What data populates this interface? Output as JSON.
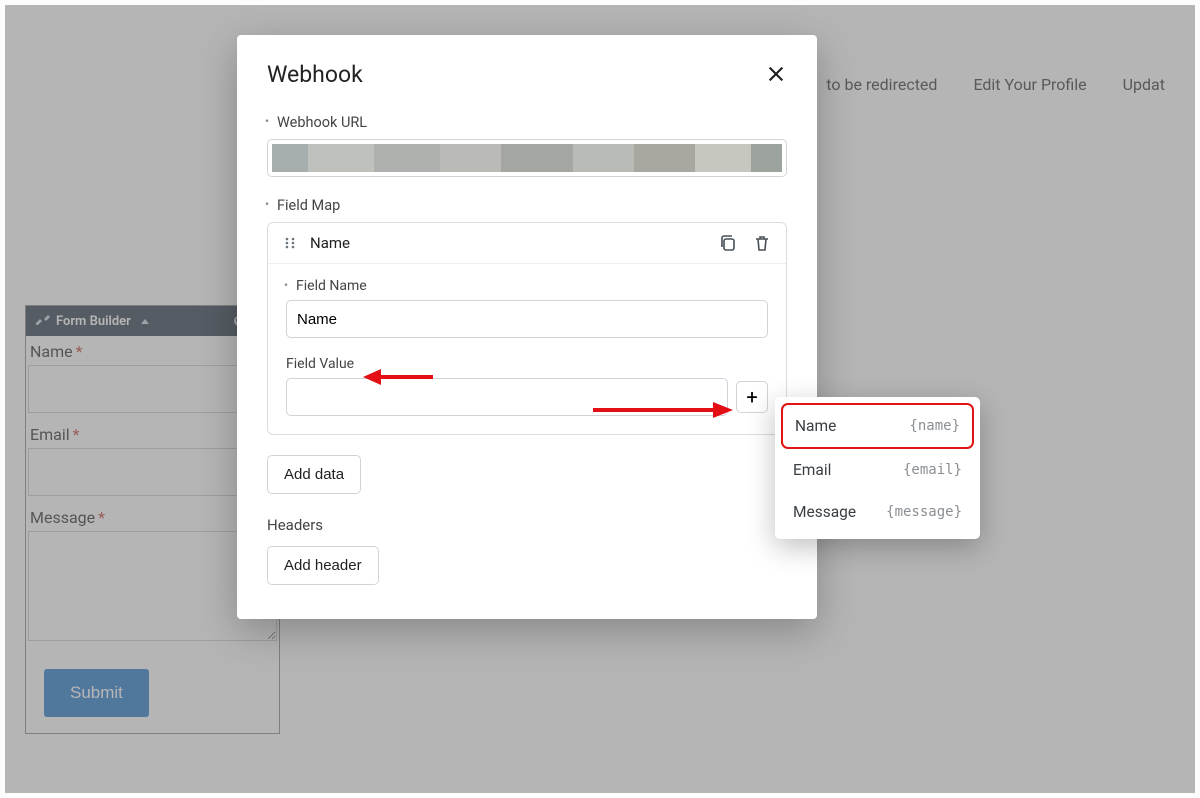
{
  "header": {
    "link1": "to be redirected",
    "link2": "Edit Your Profile",
    "link3": "Updat"
  },
  "form_builder": {
    "toolbar_title": "Form Builder",
    "fields": [
      {
        "label": "Name",
        "required": true,
        "type": "input"
      },
      {
        "label": "Email",
        "required": true,
        "type": "input"
      },
      {
        "label": "Message",
        "required": true,
        "type": "textarea"
      }
    ],
    "submit_label": "Submit"
  },
  "modal": {
    "title": "Webhook",
    "url_label": "Webhook URL",
    "field_map_label": "Field Map",
    "map_item_name": "Name",
    "field_name_label": "Field Name",
    "field_name_value": "Name",
    "field_value_label": "Field Value",
    "add_data_label": "Add data",
    "headers_label": "Headers",
    "add_header_label": "Add header"
  },
  "popover": {
    "items": [
      {
        "label": "Name",
        "tag": "{name}",
        "selected": true
      },
      {
        "label": "Email",
        "tag": "{email}",
        "selected": false
      },
      {
        "label": "Message",
        "tag": "{message}",
        "selected": false
      }
    ]
  }
}
